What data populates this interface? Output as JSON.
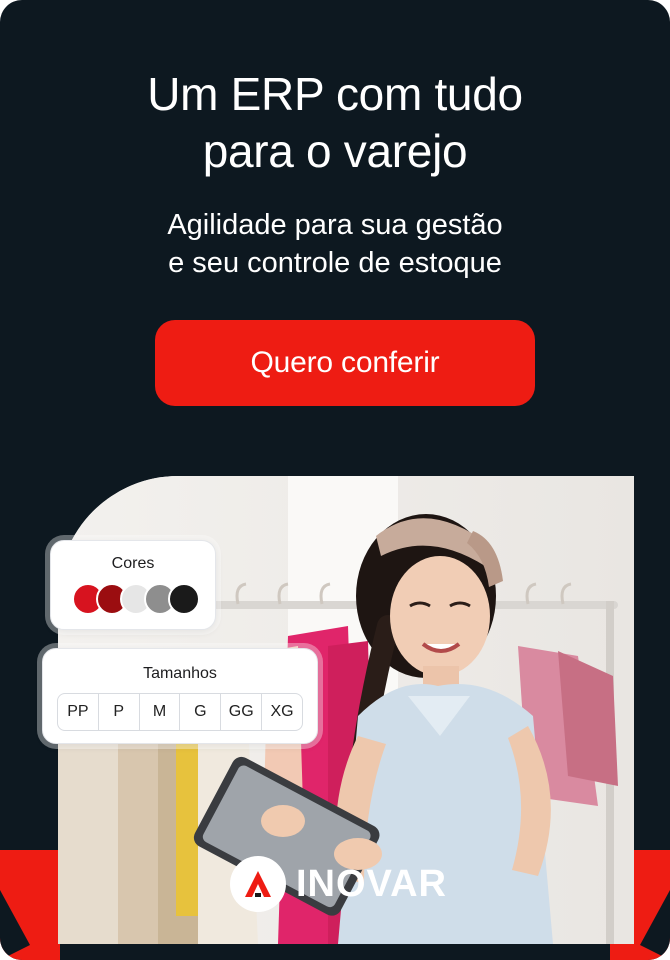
{
  "hero": {
    "headline_line1": "Um ERP com tudo",
    "headline_line2": "para o varejo",
    "subheadline_line1": "Agilidade para sua gestão",
    "subheadline_line2": "e seu controle de estoque",
    "cta_label": "Quero conferir"
  },
  "colors_card": {
    "title": "Cores",
    "swatches": [
      "#d7131f",
      "#9b0d10",
      "#e6e6e6",
      "#8e8e8e",
      "#1a1a1a"
    ]
  },
  "sizes_card": {
    "title": "Tamanhos",
    "sizes": [
      "PP",
      "P",
      "M",
      "G",
      "GG",
      "XG"
    ]
  },
  "brand": {
    "name": "INOVAR",
    "accent": "#ee1c13",
    "background": "#0d1820"
  }
}
